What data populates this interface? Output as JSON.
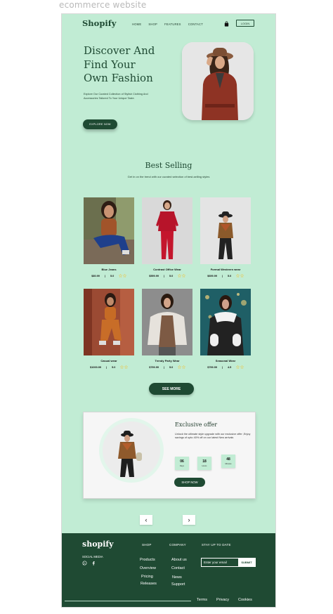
{
  "caption": "ecommerce website",
  "nav": {
    "brand": "Shopify",
    "links": [
      "HOME",
      "SHOP",
      "FEATURES",
      "CONTACT"
    ],
    "login": "LOGIN"
  },
  "hero": {
    "title_lines": [
      "Discover And",
      "Find Your",
      "Own Fashion"
    ],
    "subtitle": "Explore Our Curated Collection of Stylish Clothing And Accessories Tailored To Your Unique Taste.",
    "cta": "EXPLORE NOW"
  },
  "best_selling": {
    "title": "Best Selling",
    "subtitle": "Get in on the trend with our curated selection of best-selling styles",
    "products": [
      {
        "name": "Blue Jeans",
        "price": "$80.99",
        "rating": "5.0"
      },
      {
        "name": "Contrast Office Wear",
        "price": "$599.99",
        "rating": "5.0"
      },
      {
        "name": "Formal Westeern wear",
        "price": "$699.99",
        "rating": "5.0"
      },
      {
        "name": "Casual wear",
        "price": "$1000.99",
        "rating": "5.0"
      },
      {
        "name": "Trendy Party Wear",
        "price": "$799.99",
        "rating": "5.0"
      },
      {
        "name": "Seasonal Wear",
        "price": "$799.99",
        "rating": "4.5"
      }
    ],
    "see_more": "SEE MORE"
  },
  "offer": {
    "title": "Exclusive offer",
    "text": "Unlock the ultimate style upgrade with our exclusive offer ,Enjoy savings of upto 40% off on our latest New arrivals",
    "countdown": [
      {
        "value": "06",
        "label": "Days"
      },
      {
        "value": "18",
        "label": "Hours"
      },
      {
        "value": "48",
        "label": "Minutes"
      }
    ],
    "cta": "SHOP NOW"
  },
  "pager": {
    "prev": "‹",
    "next": "›"
  },
  "footer": {
    "brand": "shopify",
    "social": "SOCIAL MEDIA",
    "shop_head": "SHOP",
    "shop_links": [
      "Products",
      "Overview",
      "Pricing",
      "Releases"
    ],
    "company_head": "COMPANY",
    "company_links": [
      "About us",
      "Contact",
      "News",
      "Support"
    ],
    "stay_head": "STAY UP TO DATE",
    "email_placeholder": "Enter your email",
    "submit": "SUBMIT",
    "bottom_links": [
      "Terms",
      "Privacy",
      "Cookies"
    ]
  },
  "colors": {
    "mint": "#c1ecd4",
    "forest": "#1f4a33",
    "star": "#f1c232"
  }
}
